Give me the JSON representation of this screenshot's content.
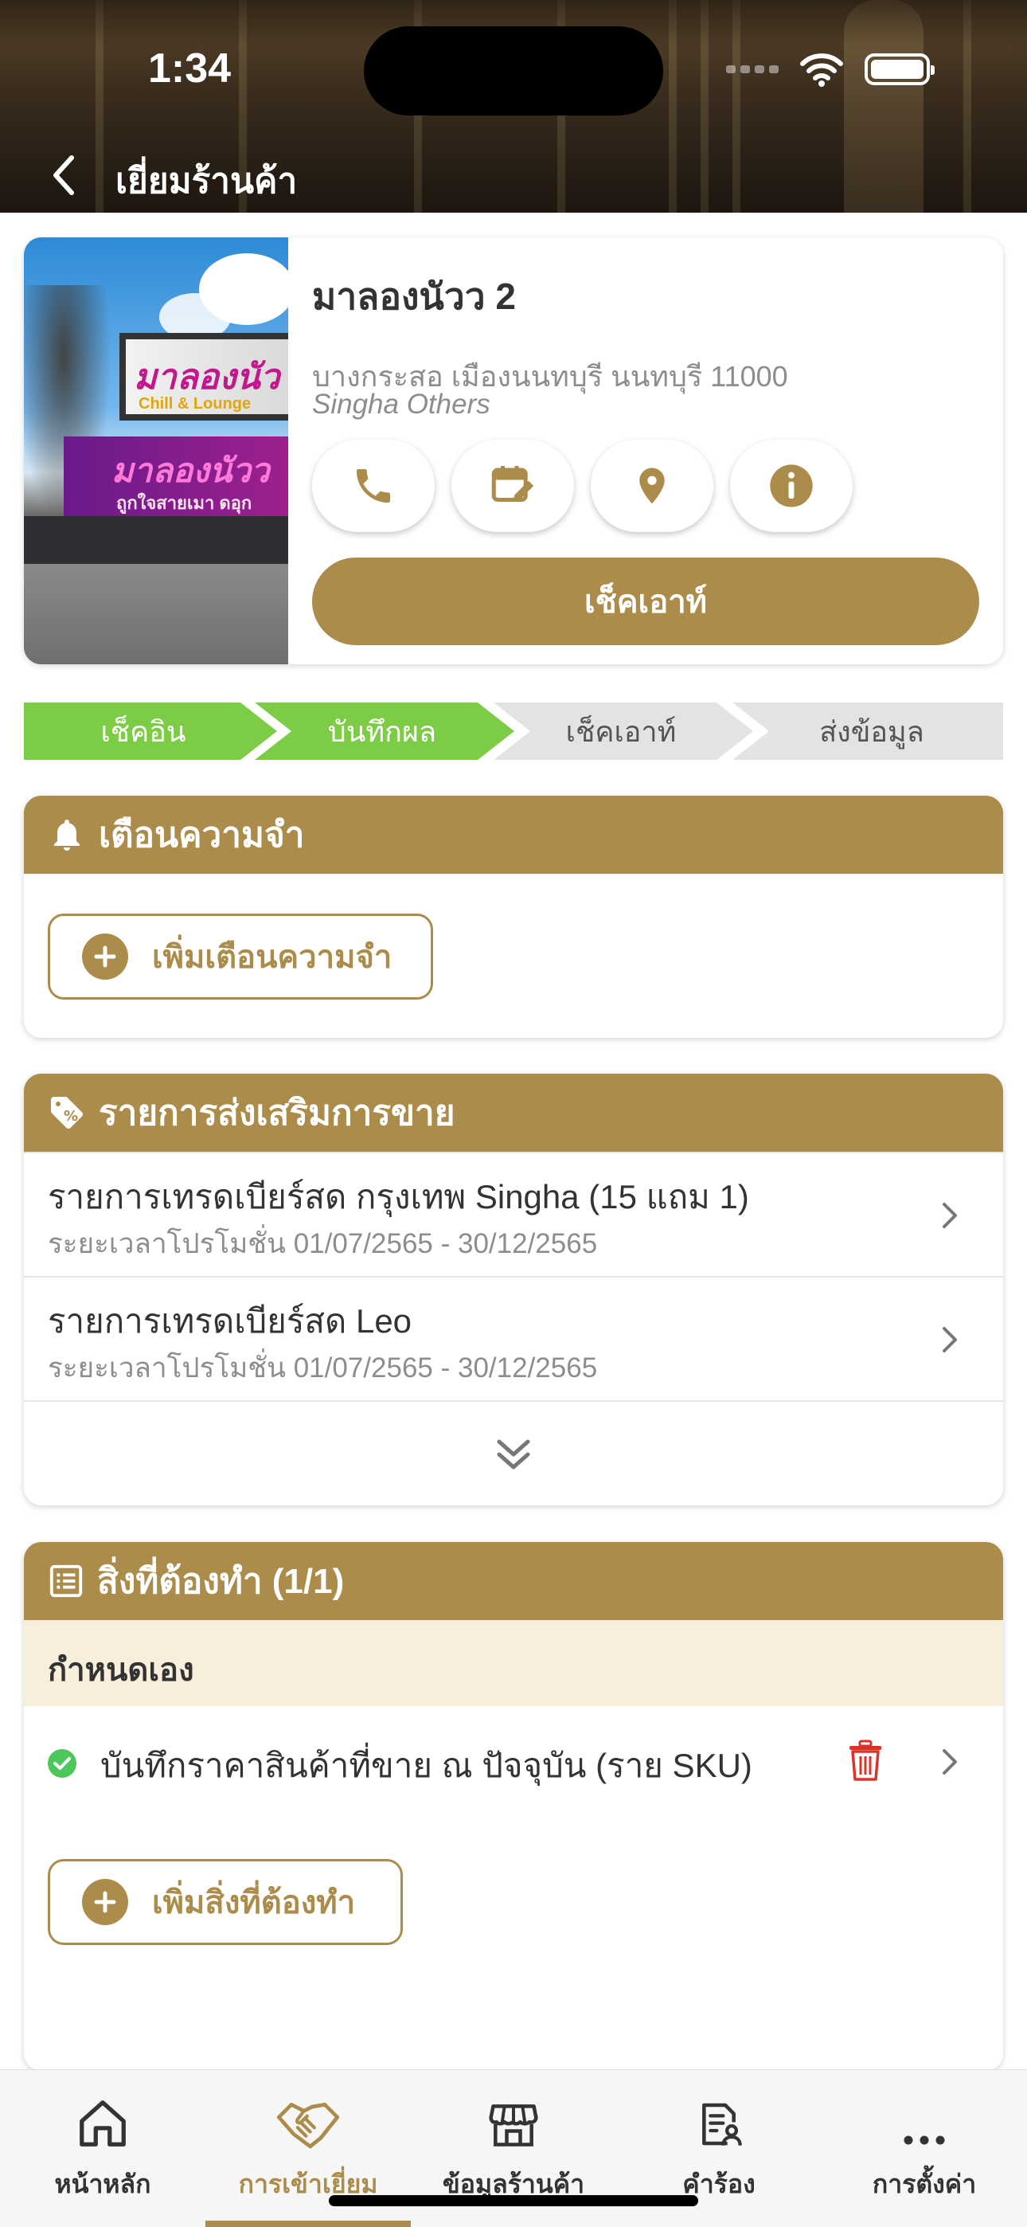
{
  "status_bar": {
    "time": "1:34"
  },
  "header": {
    "title": "เยี่ยมร้านค้า"
  },
  "store": {
    "name": "มาลองนัวว 2",
    "address": "บางกระสอ เมืองนนทบุรี นนทบุรี 11000",
    "category": "Singha Others",
    "photo_sign_main": "มาลองนัว",
    "photo_sign_sub": "Chill & Lounge",
    "photo_banner_main": "มาลองนัวว",
    "photo_banner_sub": "ถูกใจสายเมา ดอุก",
    "actions": [
      "phone-icon",
      "calendar-edit-icon",
      "location-pin-icon",
      "info-icon"
    ],
    "checkout_label": "เช็คเอาท์"
  },
  "steps": [
    {
      "label": "เช็คอิน",
      "done": true
    },
    {
      "label": "บันทึกผล",
      "done": true
    },
    {
      "label": "เช็คเอาท์",
      "done": false
    },
    {
      "label": "ส่งข้อมูล",
      "done": false
    }
  ],
  "reminder": {
    "title": "เตือนความจำ",
    "add_label": "เพิ่มเตือนความจำ"
  },
  "promotions": {
    "title": "รายการส่งเสริมการขาย",
    "items": [
      {
        "title": "รายการเทรดเบียร์สด กรุงเทพ Singha (15 แถม 1)",
        "period": "ระยะเวลาโปรโมชั่น 01/07/2565 - 30/12/2565"
      },
      {
        "title": "รายการเทรดเบียร์สด Leo",
        "period": "ระยะเวลาโปรโมชั่น 01/07/2565 - 30/12/2565"
      }
    ]
  },
  "todo": {
    "title": "สิ่งที่ต้องทำ (1/1)",
    "group_label": "กำหนดเอง",
    "items": [
      {
        "text": "บันทึกราคาสินค้าที่ขาย ณ ปัจจุบัน (ราย SKU)",
        "completed": true
      }
    ],
    "add_label": "เพิ่มสิ่งที่ต้องทำ"
  },
  "tabbar": {
    "items": [
      {
        "label": "หน้าหลัก",
        "icon": "home-icon",
        "active": false
      },
      {
        "label": "การเข้าเยี่ยม",
        "icon": "handshake-icon",
        "active": true
      },
      {
        "label": "ข้อมูลร้านค้า",
        "icon": "store-icon",
        "active": false
      },
      {
        "label": "คำร้อง",
        "icon": "request-document-icon",
        "active": false
      },
      {
        "label": "การตั้งค่า",
        "icon": "more-icon",
        "active": false
      }
    ]
  },
  "colors": {
    "accent": "#ac8c4b",
    "step_done": "#7dcc45",
    "step_todo": "#e3e3e3",
    "subhead_bg": "#f7eedb",
    "success": "#4cc75a",
    "danger": "#d9332b"
  }
}
